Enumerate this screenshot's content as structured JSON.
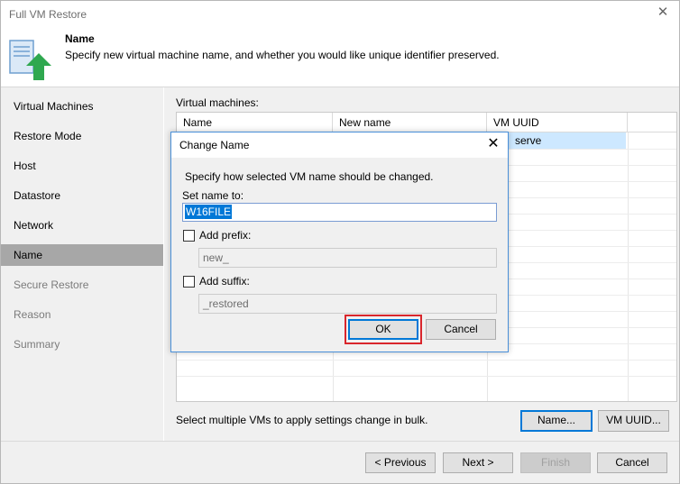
{
  "window": {
    "title": "Full VM Restore",
    "close_icon": "close-icon"
  },
  "header": {
    "title": "Name",
    "subtitle": "Specify new virtual machine name, and whether you would like unique identifier preserved.",
    "icon": "vm-restore-icon"
  },
  "sidebar": {
    "items": [
      {
        "label": "Virtual Machines",
        "state": "normal"
      },
      {
        "label": "Restore Mode",
        "state": "normal"
      },
      {
        "label": "Host",
        "state": "normal"
      },
      {
        "label": "Datastore",
        "state": "normal"
      },
      {
        "label": "Network",
        "state": "normal"
      },
      {
        "label": "Name",
        "state": "active"
      },
      {
        "label": "Secure Restore",
        "state": "disabled"
      },
      {
        "label": "Reason",
        "state": "disabled"
      },
      {
        "label": "Summary",
        "state": "disabled"
      }
    ]
  },
  "main": {
    "vm_label": "Virtual machines:",
    "columns": [
      "Name",
      "New name",
      "VM UUID"
    ],
    "selected_row_uuid_partial": "serve",
    "hint": "Select multiple VMs to apply settings change in bulk.",
    "name_button": "Name...",
    "vm_uuid_button": "VM UUID..."
  },
  "footer": {
    "previous": "< Previous",
    "next": "Next >",
    "finish": "Finish",
    "cancel": "Cancel"
  },
  "dialog": {
    "title": "Change Name",
    "instruction": "Specify how selected VM name should be changed.",
    "set_name_label": "Set name to:",
    "set_name_value": "W16FILE",
    "add_prefix_label": "Add prefix:",
    "prefix_value": "new_",
    "add_suffix_label": "Add suffix:",
    "suffix_value": "_restored",
    "ok": "OK",
    "cancel": "Cancel"
  },
  "colors": {
    "accent": "#0078d7",
    "highlight_box": "#d9262c",
    "active_nav": "#a7a7a7",
    "selection_row": "#cde8ff"
  }
}
